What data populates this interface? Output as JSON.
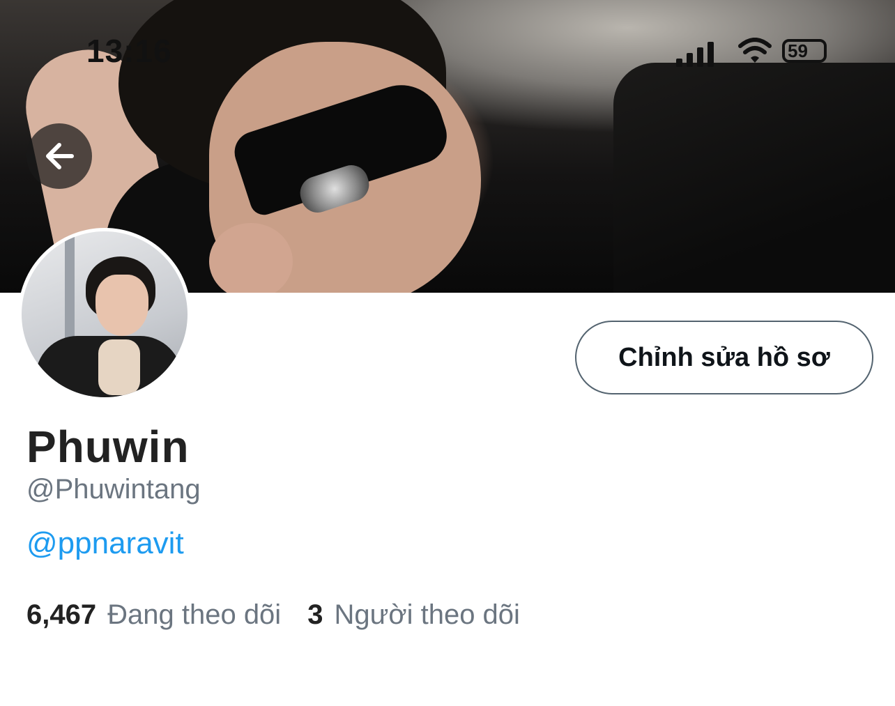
{
  "status_bar": {
    "time": "13:16",
    "battery_level": "59",
    "icons": [
      "signal-icon",
      "wifi-icon",
      "battery-icon"
    ]
  },
  "header": {
    "back_icon": "arrow-left-icon"
  },
  "profile": {
    "display_name": "Phuwin",
    "handle": "@Phuwintang",
    "bio_link": "@ppnaravit",
    "edit_button_label": "Chỉnh sửa hồ sơ"
  },
  "stats": {
    "following_count": "6,467",
    "following_label": "Đang theo dõi",
    "followers_count": "3",
    "followers_label": "Người theo dõi"
  },
  "colors": {
    "link": "#1d9bf0",
    "secondary_text": "#6b7580",
    "primary_text": "#222222",
    "button_border": "#53636f"
  }
}
